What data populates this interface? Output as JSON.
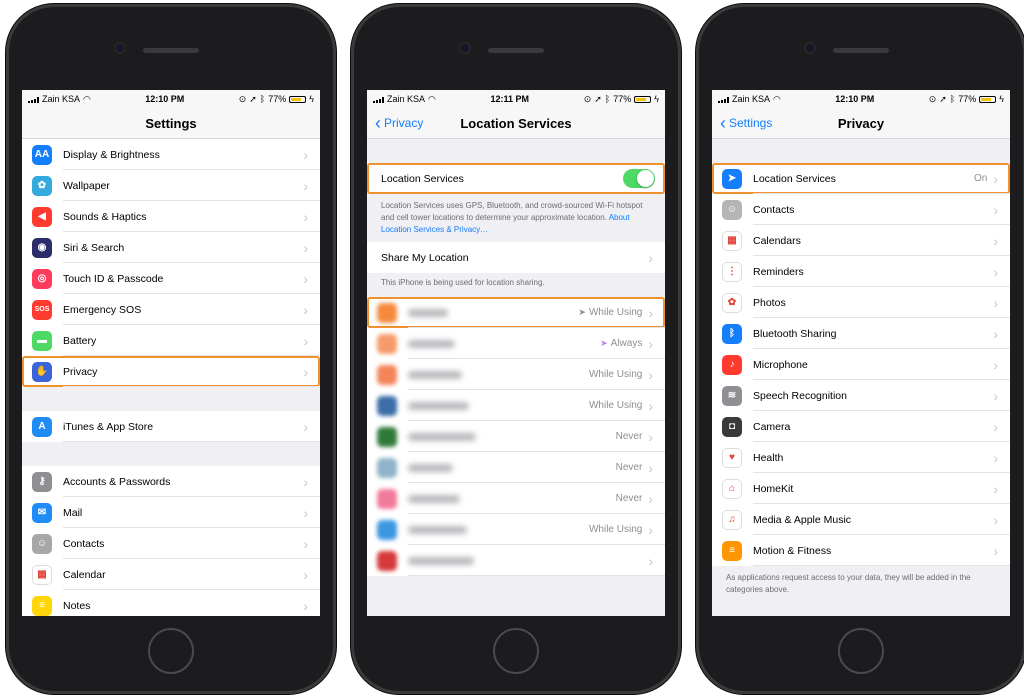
{
  "status_bars": [
    {
      "carrier": "Zain KSA",
      "time": "12:10 PM",
      "battery": "77%"
    },
    {
      "carrier": "Zain KSA",
      "time": "12:11 PM",
      "battery": "77%"
    },
    {
      "carrier": "Zain KSA",
      "time": "12:10 PM",
      "battery": "77%"
    }
  ],
  "settings": {
    "title": "Settings",
    "items": [
      {
        "label": "Display & Brightness",
        "icon": "display-icon",
        "color": "#157efb",
        "glyph": "AA"
      },
      {
        "label": "Wallpaper",
        "icon": "wallpaper-icon",
        "color": "#35aadc",
        "glyph": "✿"
      },
      {
        "label": "Sounds & Haptics",
        "icon": "sound-icon",
        "color": "#ff3b30",
        "glyph": "◀"
      },
      {
        "label": "Siri & Search",
        "icon": "siri-icon",
        "color": "#2b2d6b",
        "glyph": "◉"
      },
      {
        "label": "Touch ID & Passcode",
        "icon": "fingerprint-icon",
        "color": "#ff3b5c",
        "glyph": "◎"
      },
      {
        "label": "Emergency SOS",
        "icon": "sos-icon",
        "color": "#ff3b30",
        "glyph": "SOS"
      },
      {
        "label": "Battery",
        "icon": "battery-icon",
        "color": "#4cd964",
        "glyph": "▬"
      },
      {
        "label": "Privacy",
        "icon": "hand-icon",
        "color": "#3a65d9",
        "glyph": "✋"
      }
    ],
    "store_items": [
      {
        "label": "iTunes & App Store",
        "icon": "app-store-icon",
        "color": "#1f8cf5",
        "glyph": "A"
      }
    ],
    "account_items": [
      {
        "label": "Accounts & Passwords",
        "icon": "key-icon",
        "color": "#8e8e93",
        "glyph": "⚷"
      },
      {
        "label": "Mail",
        "icon": "mail-icon",
        "color": "#1f8cf5",
        "glyph": "✉"
      },
      {
        "label": "Contacts",
        "icon": "contacts-icon",
        "color": "#a7a7a7",
        "glyph": "☺"
      },
      {
        "label": "Calendar",
        "icon": "calendar-icon",
        "color": "#ffffff",
        "glyph": "▦"
      },
      {
        "label": "Notes",
        "icon": "notes-icon",
        "color": "#ffd60a",
        "glyph": "≡"
      }
    ]
  },
  "location": {
    "back_label": "Privacy",
    "title": "Location Services",
    "toggle_label": "Location Services",
    "description": "Location Services uses GPS, Bluetooth, and crowd-sourced Wi-Fi hotspot and cell tower locations to determine your approximate location.",
    "about_link": "About Location Services & Privacy…",
    "share_label": "Share My Location",
    "share_note": "This iPhone is being used for location sharing.",
    "apps": [
      {
        "value": "While Using",
        "arrow": "gray",
        "color": "#f58a3d"
      },
      {
        "value": "Always",
        "arrow": "purple",
        "color": "#f59a6a"
      },
      {
        "value": "While Using",
        "arrow": "",
        "color": "#f4845a"
      },
      {
        "value": "While Using",
        "arrow": "",
        "color": "#3b6ea8"
      },
      {
        "value": "Never",
        "arrow": "",
        "color": "#2f7a3a"
      },
      {
        "value": "Never",
        "arrow": "",
        "color": "#8fb3c9"
      },
      {
        "value": "Never",
        "arrow": "",
        "color": "#f27a9a"
      },
      {
        "value": "While Using",
        "arrow": "",
        "color": "#3c97e0"
      },
      {
        "value": "",
        "arrow": "",
        "color": "#d43a3a"
      }
    ]
  },
  "privacy": {
    "back_label": "Settings",
    "title": "Privacy",
    "items": [
      {
        "label": "Location Services",
        "value": "On",
        "icon": "location-arrow-icon",
        "color": "#157efb",
        "glyph": "➤"
      },
      {
        "label": "Contacts",
        "value": "",
        "icon": "contacts-icon",
        "color": "#b5b5b5",
        "glyph": "☺"
      },
      {
        "label": "Calendars",
        "value": "",
        "icon": "calendar-icon",
        "color": "#ffffff",
        "glyph": "▦"
      },
      {
        "label": "Reminders",
        "value": "",
        "icon": "reminders-icon",
        "color": "#ffffff",
        "glyph": "⋮"
      },
      {
        "label": "Photos",
        "value": "",
        "icon": "photos-icon",
        "color": "#ffffff",
        "glyph": "✿"
      },
      {
        "label": "Bluetooth Sharing",
        "value": "",
        "icon": "bluetooth-icon",
        "color": "#157efb",
        "glyph": "ᛒ"
      },
      {
        "label": "Microphone",
        "value": "",
        "icon": "microphone-icon",
        "color": "#ff3b30",
        "glyph": "♪"
      },
      {
        "label": "Speech Recognition",
        "value": "",
        "icon": "waveform-icon",
        "color": "#8e8e93",
        "glyph": "≋"
      },
      {
        "label": "Camera",
        "value": "",
        "icon": "camera-icon",
        "color": "#3a3a3c",
        "glyph": "◘"
      },
      {
        "label": "Health",
        "value": "",
        "icon": "heart-icon",
        "color": "#ffffff",
        "glyph": "♥"
      },
      {
        "label": "HomeKit",
        "value": "",
        "icon": "home-icon",
        "color": "#ffffff",
        "glyph": "⌂"
      },
      {
        "label": "Media & Apple Music",
        "value": "",
        "icon": "music-icon",
        "color": "#ffffff",
        "glyph": "♫"
      },
      {
        "label": "Motion & Fitness",
        "value": "",
        "icon": "motion-icon",
        "color": "#ff9500",
        "glyph": "≡"
      }
    ],
    "footer": "As applications request access to your data, they will be added in the categories above."
  }
}
